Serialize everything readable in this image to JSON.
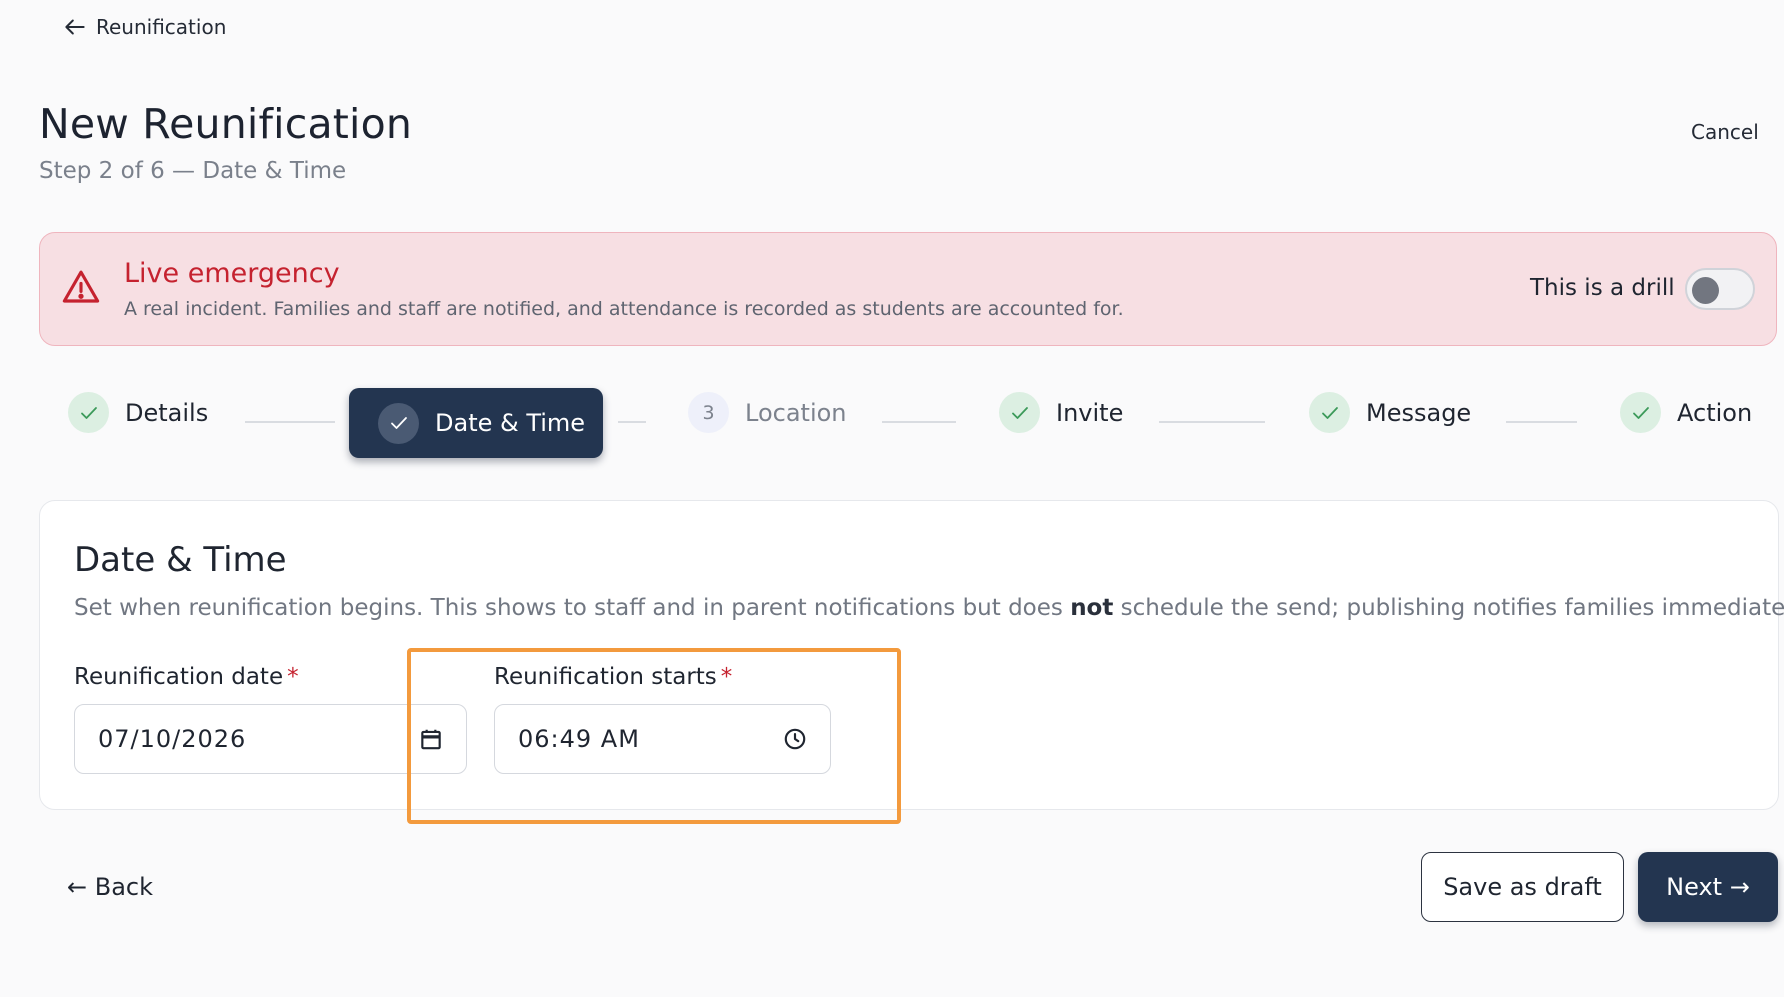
{
  "breadcrumb": {
    "label": "Reunification"
  },
  "header": {
    "title": "New Reunification",
    "subtitle": "Step 2 of 6 — Date & Time",
    "cancel_label": "Cancel"
  },
  "alert": {
    "title": "Live emergency",
    "description": "A real incident. Families and staff are notified, and attendance is recorded as students are accounted for.",
    "drill_label": "This is a drill",
    "drill_enabled": false,
    "icon": "warning-triangle-icon"
  },
  "stepper": {
    "steps": [
      {
        "label": "Details",
        "state": "complete",
        "icon": "check-icon"
      },
      {
        "label": "Date & Time",
        "state": "active",
        "icon": "check-icon"
      },
      {
        "label": "Location",
        "state": "pending",
        "number": "3"
      },
      {
        "label": "Invite",
        "state": "complete",
        "icon": "check-icon"
      },
      {
        "label": "Message",
        "state": "complete",
        "icon": "check-icon"
      },
      {
        "label": "Action",
        "state": "complete",
        "icon": "check-icon"
      }
    ]
  },
  "card": {
    "title": "Date & Time",
    "desc_before": "Set when reunification begins. This shows to staff and in parent notifications but does ",
    "desc_bold": "not",
    "desc_after": " schedule the send; publishing notifies families immediately.",
    "date_field": {
      "label": "Reunification date",
      "required_mark": "*",
      "value": "07/10/2026",
      "icon": "calendar-icon"
    },
    "time_field": {
      "label": "Reunification starts",
      "required_mark": "*",
      "value": "06:49  AM",
      "icon": "clock-icon"
    }
  },
  "footer": {
    "back_label": "← Back",
    "draft_label": "Save as draft",
    "next_label": "Next →"
  },
  "colors": {
    "primary": "#233550",
    "danger": "#c5222f",
    "alert_bg": "#f7dfe3",
    "success_bg": "#dcefe2",
    "success": "#3c9a5a",
    "highlight": "#f39a3d"
  }
}
